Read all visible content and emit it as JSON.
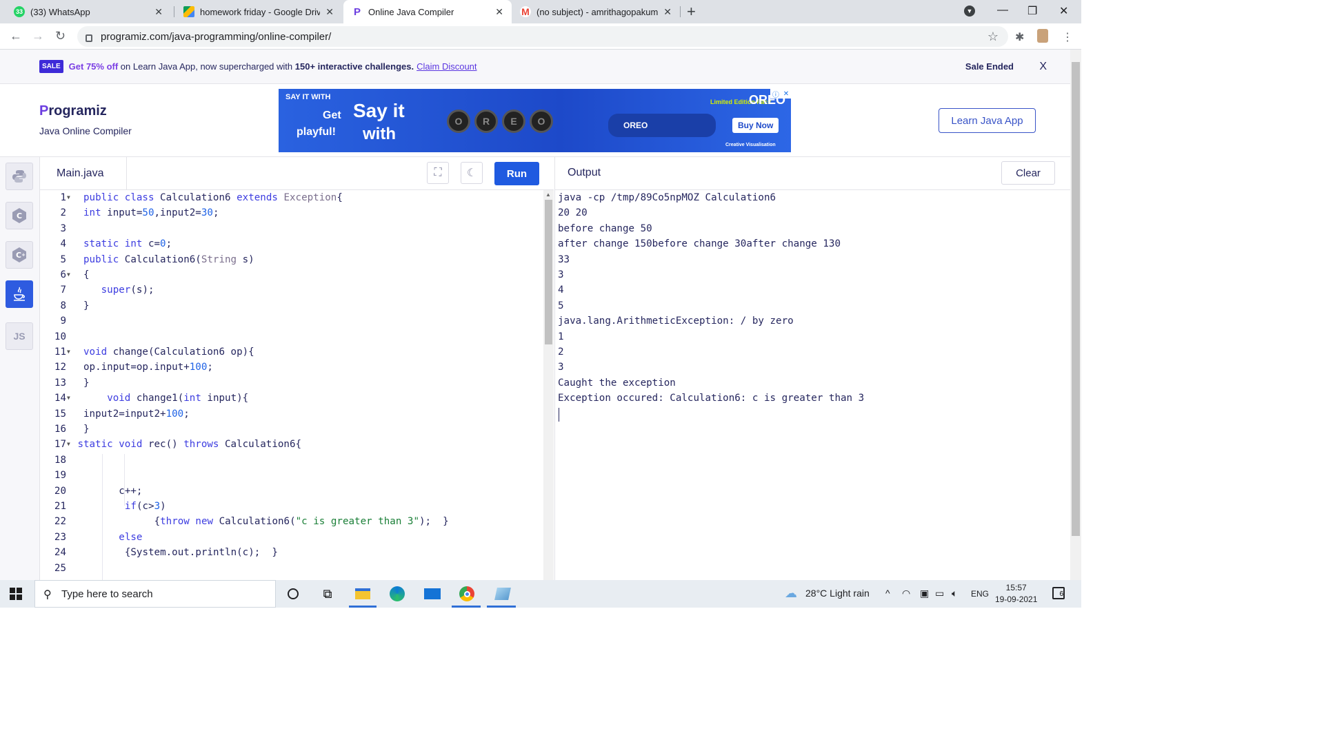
{
  "browser": {
    "tabs": [
      {
        "title": "(33) WhatsApp",
        "badge": "33",
        "color": "#25d366"
      },
      {
        "title": "homework friday - Google Drive",
        "color": "#fbbc04"
      },
      {
        "title": "Online Java Compiler",
        "color": "#6b3de0"
      },
      {
        "title": "(no subject) - amrithagopakumar",
        "color": "#ea4335"
      }
    ],
    "url": "programiz.com/java-programming/online-compiler/"
  },
  "sale": {
    "badge": "SALE",
    "highlight": "Get 75% off",
    "middle": " on Learn Java App, now supercharged with ",
    "bold2": "150+ interactive challenges.",
    "link": "Claim Discount",
    "ended": "Sale Ended",
    "close": "X"
  },
  "header": {
    "logo_p": "P",
    "logo_rest": "rogramiz",
    "subtitle": "Java Online Compiler",
    "learn_button": "Learn Java App"
  },
  "ad": {
    "l1": "SAY IT WITH",
    "l2": "Get",
    "l3": "playful!",
    "l4": "Say it",
    "l5": "with",
    "cookies": [
      "O",
      "R",
      "E",
      "O"
    ],
    "limited": "Limited Edition Pack",
    "pack": "OREO",
    "buy": "Buy Now",
    "brand": "OREO",
    "cv": "Creative Visualisation"
  },
  "sidebar": {
    "langs": [
      {
        "label": "py",
        "icon": "python-icon"
      },
      {
        "label": "C",
        "icon": "c-icon"
      },
      {
        "label": "C+",
        "icon": "cpp-icon"
      },
      {
        "label": "☕",
        "icon": "java-icon"
      },
      {
        "label": "JS",
        "icon": "javascript-icon"
      }
    ]
  },
  "editor": {
    "filename": "Main.java",
    "run": "Run",
    "lines": [
      {
        "n": "1",
        "fold": true,
        "indent": 0,
        "text": "public class Calculation6 extends Exception{"
      },
      {
        "n": "2",
        "fold": false,
        "indent": 0,
        "text": "int input=50,input2=30;"
      },
      {
        "n": "3",
        "fold": false,
        "indent": 0,
        "text": ""
      },
      {
        "n": "4",
        "fold": false,
        "indent": 0,
        "text": "static int c=0;"
      },
      {
        "n": "5",
        "fold": false,
        "indent": 0,
        "text": "public Calculation6(String s)"
      },
      {
        "n": "6",
        "fold": true,
        "indent": 0,
        "text": "{"
      },
      {
        "n": "7",
        "fold": false,
        "indent": 3,
        "text": "super(s);"
      },
      {
        "n": "8",
        "fold": false,
        "indent": 0,
        "text": "}"
      },
      {
        "n": "9",
        "fold": false,
        "indent": 0,
        "text": ""
      },
      {
        "n": "10",
        "fold": false,
        "indent": 0,
        "text": ""
      },
      {
        "n": "11",
        "fold": true,
        "indent": 0,
        "text": "void change(Calculation6 op){"
      },
      {
        "n": "12",
        "fold": false,
        "indent": 0,
        "text": "op.input=op.input+100;"
      },
      {
        "n": "13",
        "fold": false,
        "indent": 0,
        "text": "}"
      },
      {
        "n": "14",
        "fold": true,
        "indent": 4,
        "text": "void change1(int input){"
      },
      {
        "n": "15",
        "fold": false,
        "indent": 0,
        "text": "input2=input2+100;"
      },
      {
        "n": "16",
        "fold": false,
        "indent": 0,
        "text": "}"
      },
      {
        "n": "17",
        "fold": true,
        "indent": -1,
        "text": "static void rec() throws Calculation6{"
      },
      {
        "n": "18",
        "fold": false,
        "indent": 0,
        "text": ""
      },
      {
        "n": "19",
        "fold": false,
        "indent": 0,
        "text": ""
      },
      {
        "n": "20",
        "fold": false,
        "indent": 6,
        "text": "c++;"
      },
      {
        "n": "21",
        "fold": false,
        "indent": 7,
        "text": "if(c>3)"
      },
      {
        "n": "22",
        "fold": false,
        "indent": 12,
        "text": "{throw new Calculation6(\"c is greater than 3\");  }"
      },
      {
        "n": "23",
        "fold": false,
        "indent": 6,
        "text": "else"
      },
      {
        "n": "24",
        "fold": false,
        "indent": 7,
        "text": "{System.out.println(c);  }"
      },
      {
        "n": "25",
        "fold": false,
        "indent": 0,
        "text": ""
      }
    ]
  },
  "output": {
    "title": "Output",
    "clear": "Clear",
    "lines": [
      "java -cp /tmp/89Co5npMOZ Calculation6",
      "20 20",
      "before change 50",
      "after change 150before change 30after change 130",
      "33",
      "3",
      "4",
      "5",
      "java.lang.ArithmeticException: / by zero",
      "1",
      "2",
      "3",
      "Caught the exception",
      "Exception occured: Calculation6: c is greater than 3"
    ]
  },
  "taskbar": {
    "search_placeholder": "Type here to search",
    "weather": "28°C  Light rain",
    "lang": "ENG",
    "time": "15:57",
    "date": "19-09-2021",
    "notif_count": "6"
  }
}
